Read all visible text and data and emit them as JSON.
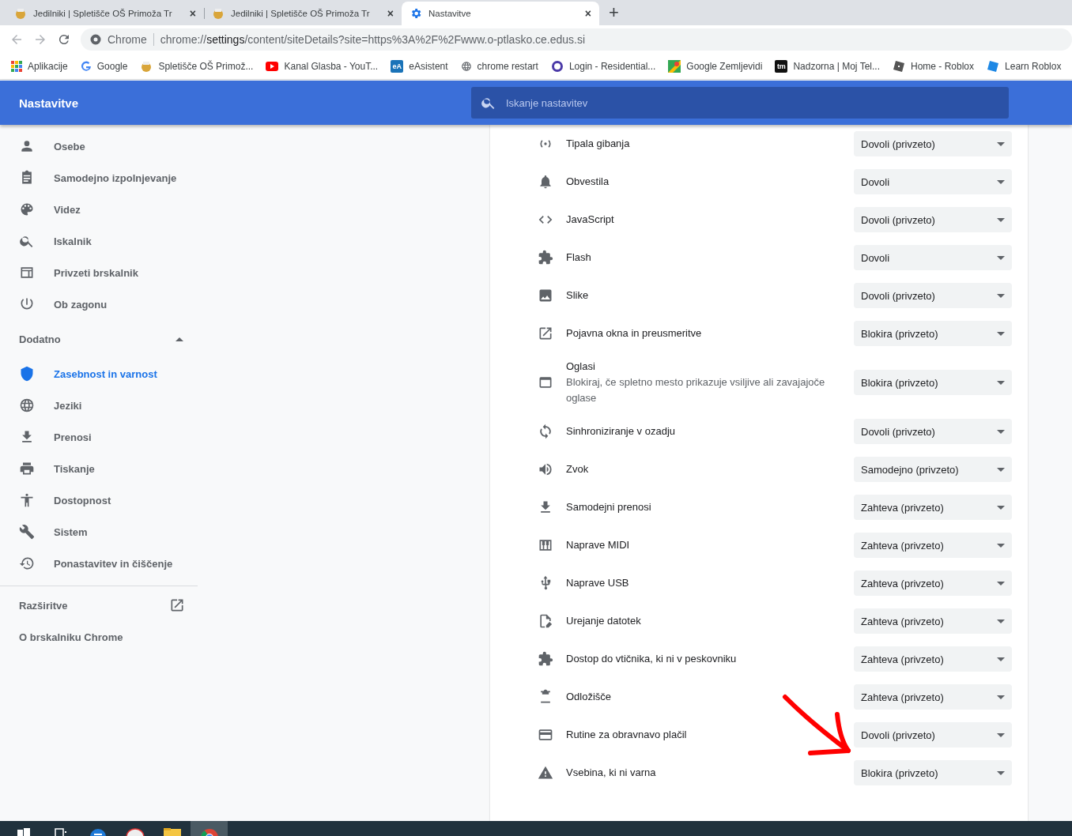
{
  "tabs": [
    {
      "title": "Jedilniki | Spletišče OŠ Primoža Tr",
      "close": "×",
      "selected": false
    },
    {
      "title": "Jedilniki | Spletišče OŠ Primoža Tr",
      "close": "×",
      "selected": false
    },
    {
      "title": "Nastavitve",
      "close": "×",
      "selected": true
    }
  ],
  "new_tab": "+",
  "address": {
    "site_label": "Chrome",
    "url_prefix": "chrome://",
    "url_host": "settings",
    "url_path": "/content/siteDetails?site=https%3A%2F%2Fwww.o-ptlasko.ce.edus.si"
  },
  "bookmarks": [
    {
      "label": "Aplikacije"
    },
    {
      "label": "Google"
    },
    {
      "label": "Spletišče OŠ Primož..."
    },
    {
      "label": "Kanal Glasba - YouT..."
    },
    {
      "label": "eAsistent",
      "icon_text": "eA",
      "color": "#1a73b8"
    },
    {
      "label": "chrome restart"
    },
    {
      "label": "Login - Residential..."
    },
    {
      "label": "Google Zemljevidi"
    },
    {
      "label": "Nadzorna | Moj Tel...",
      "icon_text": "tm",
      "color": "#111111"
    },
    {
      "label": "Home - Roblox"
    },
    {
      "label": "Learn Roblox"
    }
  ],
  "header": {
    "title": "Nastavitve",
    "search": {
      "placeholder": "Iskanje nastavitev"
    }
  },
  "sidebar": {
    "items": [
      {
        "label": "Osebe",
        "selected": false
      },
      {
        "label": "Samodejno izpolnjevanje",
        "selected": false
      },
      {
        "label": "Videz",
        "selected": false
      },
      {
        "label": "Iskalnik",
        "selected": false
      },
      {
        "label": "Privzeti brskalnik",
        "selected": false
      },
      {
        "label": "Ob zagonu",
        "selected": false
      }
    ],
    "advanced": {
      "label": "Dodatno",
      "expanded": true,
      "items": [
        {
          "label": "Zasebnost in varnost",
          "selected": true
        },
        {
          "label": "Jeziki",
          "selected": false
        },
        {
          "label": "Prenosi",
          "selected": false
        },
        {
          "label": "Tiskanje",
          "selected": false
        },
        {
          "label": "Dostopnost",
          "selected": false
        },
        {
          "label": "Sistem",
          "selected": false
        },
        {
          "label": "Ponastavitev in čiščenje",
          "selected": false
        }
      ]
    },
    "extensions": "Razširitve",
    "about": "O brskalniku Chrome"
  },
  "permissions": [
    {
      "label": "Tipala gibanja",
      "value": "Dovoli (privzeto)"
    },
    {
      "label": "Obvestila",
      "value": "Dovoli"
    },
    {
      "label": "JavaScript",
      "value": "Dovoli (privzeto)"
    },
    {
      "label": "Flash",
      "value": "Dovoli"
    },
    {
      "label": "Slike",
      "value": "Dovoli (privzeto)"
    },
    {
      "label": "Pojavna okna in preusmeritve",
      "value": "Blokira (privzeto)"
    },
    {
      "label": "Oglasi",
      "description": "Blokiraj, če spletno mesto prikazuje vsiljive ali zavajajoče oglase",
      "value": "Blokira (privzeto)"
    },
    {
      "label": "Sinhroniziranje v ozadju",
      "value": "Dovoli (privzeto)"
    },
    {
      "label": "Zvok",
      "value": "Samodejno (privzeto)"
    },
    {
      "label": "Samodejni prenosi",
      "value": "Zahteva (privzeto)"
    },
    {
      "label": "Naprave MIDI",
      "value": "Zahteva (privzeto)"
    },
    {
      "label": "Naprave USB",
      "value": "Zahteva (privzeto)"
    },
    {
      "label": "Urejanje datotek",
      "value": "Zahteva (privzeto)"
    },
    {
      "label": "Dostop do vtičnika, ki ni v peskovniku",
      "value": "Zahteva (privzeto)"
    },
    {
      "label": "Odložišče",
      "value": "Zahteva (privzeto)"
    },
    {
      "label": "Rutine za obravnavo plačil",
      "value": "Dovoli (privzeto)"
    },
    {
      "label": "Vsebina, ki ni varna",
      "value": "Blokira (privzeto)"
    }
  ],
  "taskbar": [
    {
      "kind": "start",
      "selected": false
    },
    {
      "kind": "taskview",
      "selected": false
    },
    {
      "kind": "edge",
      "selected": false
    },
    {
      "kind": "app",
      "selected": false
    },
    {
      "kind": "folder",
      "selected": false
    },
    {
      "kind": "chrome",
      "selected": true
    }
  ]
}
